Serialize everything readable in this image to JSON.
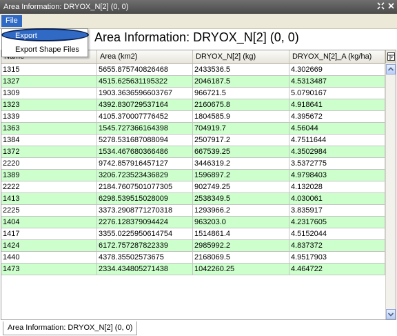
{
  "window": {
    "title": "Area Information: DRYOX_N[2] (0, 0)"
  },
  "menu": {
    "file_label": "File"
  },
  "dropdown": {
    "export_label": "Export",
    "export_shape_label": "Export Shape Files"
  },
  "header": {
    "title": "Area Information: DRYOX_N[2] (0, 0)"
  },
  "table": {
    "columns": [
      "Name",
      "Area (km2)",
      "DRYOX_N[2] (kg)",
      "DRYOX_N[2]_A (kg/ha)"
    ],
    "rows": [
      [
        "1315",
        "5655.875740826468",
        "2433536.5",
        "4.302669"
      ],
      [
        "1327",
        "4515.625631195322",
        "2046187.5",
        "4.5313487"
      ],
      [
        "1309",
        "1903.3636596603767",
        "966721.5",
        "5.0790167"
      ],
      [
        "1323",
        "4392.830729537164",
        "2160675.8",
        "4.918641"
      ],
      [
        "1339",
        "4105.370007776452",
        "1804585.9",
        "4.395672"
      ],
      [
        "1363",
        "1545.727366164398",
        "704919.7",
        "4.56044"
      ],
      [
        "1384",
        "5278.531687088094",
        "2507917.2",
        "4.7511644"
      ],
      [
        "1372",
        "1534.467680366486",
        "667539.25",
        "4.3502984"
      ],
      [
        "2220",
        "9742.857916457127",
        "3446319.2",
        "3.5372775"
      ],
      [
        "1389",
        "3206.723523436829",
        "1596897.2",
        "4.9798403"
      ],
      [
        "2222",
        "2184.7607501077305",
        "902749.25",
        "4.132028"
      ],
      [
        "1413",
        "6298.539515028009",
        "2538349.5",
        "4.030061"
      ],
      [
        "2225",
        "3373.2908771270318",
        "1293966.2",
        "3.835917"
      ],
      [
        "1404",
        "2276.128379094424",
        "963203.0",
        "4.2317605"
      ],
      [
        "1417",
        "3355.0225950614754",
        "1514861.4",
        "4.5152044"
      ],
      [
        "1424",
        "6172.757287822339",
        "2985992.2",
        "4.837372"
      ],
      [
        "1440",
        "4378.35502573675",
        "2168069.5",
        "4.9517903"
      ],
      [
        "1473",
        "2334.434805271438",
        "1042260.25",
        "4.464722"
      ]
    ]
  },
  "bottom_tab": {
    "label": "Area Information: DRYOX_N[2] (0, 0)"
  },
  "icons": {
    "maximize": "maximize-icon",
    "close": "close-icon",
    "column_settings": "column-settings-icon",
    "scroll_up": "scroll-up-arrow",
    "scroll_down": "scroll-down-arrow"
  },
  "colors": {
    "row_even": "#ccffcc",
    "row_odd": "#ffffff",
    "selection": "#316ac5",
    "titlebar": "#4a4a4a"
  }
}
